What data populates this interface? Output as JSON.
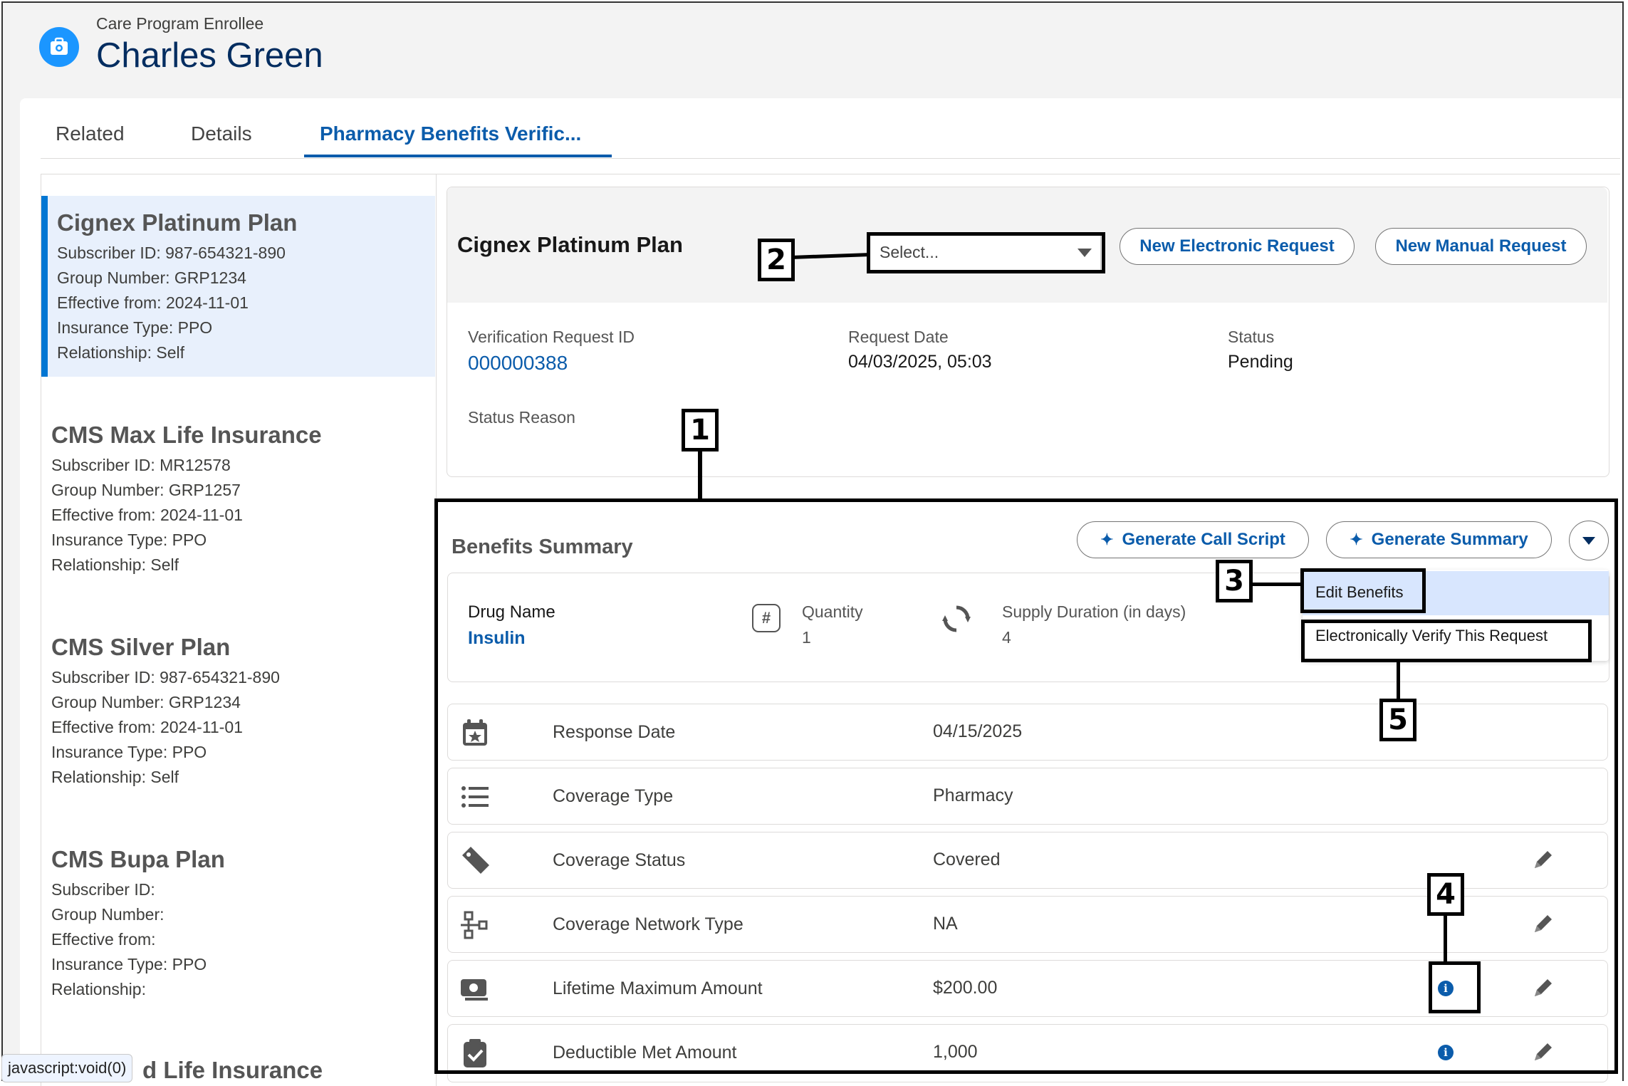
{
  "header": {
    "object_type": "Care Program Enrollee",
    "name": "Charles Green"
  },
  "tabs": [
    {
      "label": "Related"
    },
    {
      "label": "Details"
    },
    {
      "label": "Pharmacy Benefits Verific..."
    }
  ],
  "plans": [
    {
      "name": "Cignex Platinum Plan",
      "lines": [
        "Subscriber ID: 987-654321-890",
        "Group Number: GRP1234",
        "Effective from: 2024-11-01",
        "Insurance Type: PPO",
        "Relationship: Self"
      ]
    },
    {
      "name": "CMS Max Life Insurance",
      "lines": [
        "Subscriber ID: MR12578",
        "Group Number: GRP1257",
        "Effective from: 2024-11-01",
        "Insurance Type: PPO",
        "Relationship: Self"
      ]
    },
    {
      "name": "CMS Silver Plan",
      "lines": [
        "Subscriber ID: 987-654321-890",
        "Group Number: GRP1234",
        "Effective from: 2024-11-01",
        "Insurance Type: PPO",
        "Relationship: Self"
      ]
    },
    {
      "name": "CMS Bupa Plan",
      "lines": [
        "Subscriber ID:",
        "Group Number:",
        "Effective from:",
        "Insurance Type: PPO",
        "Relationship:"
      ]
    },
    {
      "name": "d Life Insurance"
    }
  ],
  "status_bar": "javascript:void(0)",
  "request": {
    "title": "Cignex Platinum Plan",
    "select_placeholder": "Select...",
    "new_electronic": "New Electronic Request",
    "new_manual": "New Manual Request",
    "fields": {
      "vr_id_label": "Verification Request ID",
      "vr_id": "000000388",
      "date_label": "Request Date",
      "date": "04/03/2025, 05:03",
      "status_label": "Status",
      "status": "Pending",
      "reason_label": "Status Reason"
    }
  },
  "benefits": {
    "title": "Benefits Summary",
    "gen_call_script": "Generate Call Script",
    "gen_summary": "Generate Summary",
    "drug": {
      "name_label": "Drug Name",
      "name": "Insulin",
      "qty_label": "Quantity",
      "qty": "1",
      "supply_label": "Supply Duration (in days)",
      "supply": "4"
    },
    "menu": [
      "Edit Benefits",
      "Electronically Verify This Request"
    ],
    "rows": [
      {
        "label": "Response Date",
        "value": "04/15/2025",
        "icon": "calendar-star-icon"
      },
      {
        "label": "Coverage Type",
        "value": "Pharmacy",
        "icon": "list-icon"
      },
      {
        "label": "Coverage Status",
        "value": "Covered",
        "icon": "tag-icon"
      },
      {
        "label": "Coverage Network Type",
        "value": "NA",
        "icon": "network-icon"
      },
      {
        "label": "Lifetime Maximum Amount",
        "value": "$200.00",
        "icon": "money-icon"
      },
      {
        "label": "Deductible Met Amount",
        "value": "1,000",
        "icon": "clipboard-check-icon"
      }
    ]
  },
  "annotations": [
    "1",
    "2",
    "3",
    "4",
    "5"
  ],
  "colors": {
    "accent": "#0b5cab",
    "brand_icon": "#1b96ff",
    "title": "#032d60",
    "selected_bg": "#e8f0fc"
  }
}
